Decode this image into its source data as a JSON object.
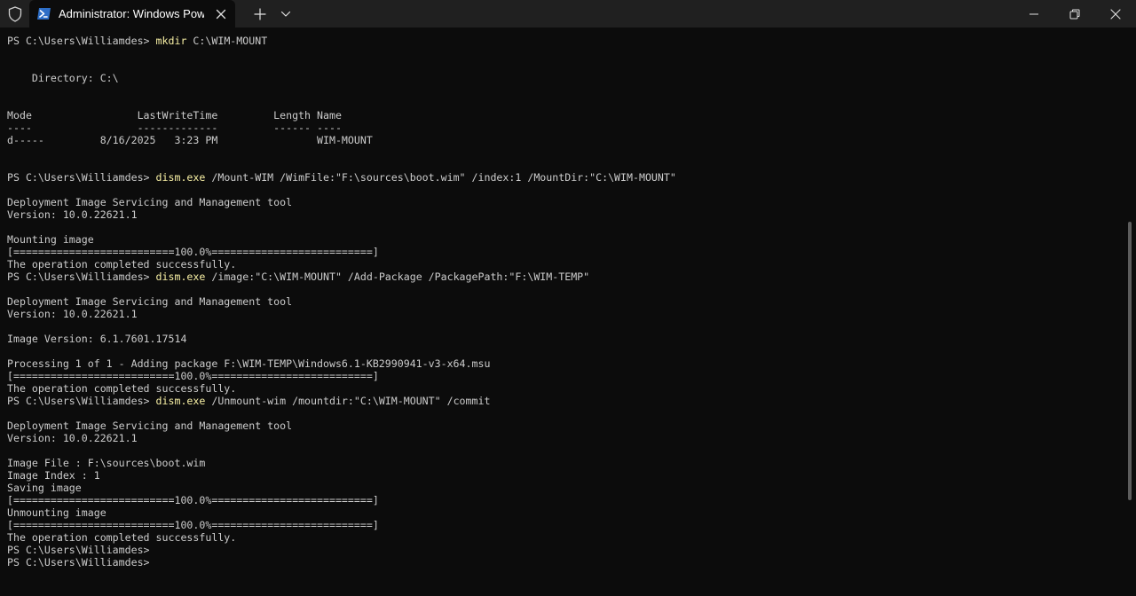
{
  "titlebar": {
    "tab_title": "Administrator: Windows PowerShell",
    "icons": {
      "shield": "shield-icon",
      "powershell": "powershell-icon",
      "tab_close": "close-icon",
      "new_tab": "plus-icon",
      "dropdown": "chevron-down-icon",
      "minimize": "minimize-icon",
      "restore": "restore-icon",
      "close": "close-icon"
    }
  },
  "colors": {
    "terminal_bg": "#0c0c0c",
    "titlebar_bg": "#202020",
    "text": "#cccccc",
    "command": "#f9f1a5",
    "powershell_blue": "#2d6ec7"
  },
  "terminal": {
    "lines": [
      {
        "prompt": "PS C:\\Users\\Williamdes> ",
        "cmd": "mkdir",
        "rest": " C:\\WIM-MOUNT"
      },
      {
        "text": ""
      },
      {
        "text": ""
      },
      {
        "text": "    Directory: C:\\"
      },
      {
        "text": ""
      },
      {
        "text": ""
      },
      {
        "text": "Mode                 LastWriteTime         Length Name"
      },
      {
        "text": "----                 -------------         ------ ----"
      },
      {
        "text": "d-----         8/16/2025   3:23 PM                WIM-MOUNT"
      },
      {
        "text": ""
      },
      {
        "text": ""
      },
      {
        "prompt": "PS C:\\Users\\Williamdes> ",
        "cmd": "dism.exe",
        "rest": " /Mount-WIM /WimFile:\"F:\\sources\\boot.wim\" /index:1 /MountDir:\"C:\\WIM-MOUNT\""
      },
      {
        "text": ""
      },
      {
        "text": "Deployment Image Servicing and Management tool"
      },
      {
        "text": "Version: 10.0.22621.1"
      },
      {
        "text": ""
      },
      {
        "text": "Mounting image"
      },
      {
        "text": "[==========================100.0%==========================]"
      },
      {
        "text": "The operation completed successfully."
      },
      {
        "prompt": "PS C:\\Users\\Williamdes> ",
        "cmd": "dism.exe",
        "rest": " /image:\"C:\\WIM-MOUNT\" /Add-Package /PackagePath:\"F:\\WIM-TEMP\""
      },
      {
        "text": ""
      },
      {
        "text": "Deployment Image Servicing and Management tool"
      },
      {
        "text": "Version: 10.0.22621.1"
      },
      {
        "text": ""
      },
      {
        "text": "Image Version: 6.1.7601.17514"
      },
      {
        "text": ""
      },
      {
        "text": "Processing 1 of 1 - Adding package F:\\WIM-TEMP\\Windows6.1-KB2990941-v3-x64.msu"
      },
      {
        "text": "[==========================100.0%==========================]"
      },
      {
        "text": "The operation completed successfully."
      },
      {
        "prompt": "PS C:\\Users\\Williamdes> ",
        "cmd": "dism.exe",
        "rest": " /Unmount-wim /mountdir:\"C:\\WIM-MOUNT\" /commit"
      },
      {
        "text": ""
      },
      {
        "text": "Deployment Image Servicing and Management tool"
      },
      {
        "text": "Version: 10.0.22621.1"
      },
      {
        "text": ""
      },
      {
        "text": "Image File : F:\\sources\\boot.wim"
      },
      {
        "text": "Image Index : 1"
      },
      {
        "text": "Saving image"
      },
      {
        "text": "[==========================100.0%==========================]"
      },
      {
        "text": "Unmounting image"
      },
      {
        "text": "[==========================100.0%==========================]"
      },
      {
        "text": "The operation completed successfully."
      },
      {
        "text": "PS C:\\Users\\Williamdes>"
      },
      {
        "text": "PS C:\\Users\\Williamdes>"
      }
    ]
  }
}
